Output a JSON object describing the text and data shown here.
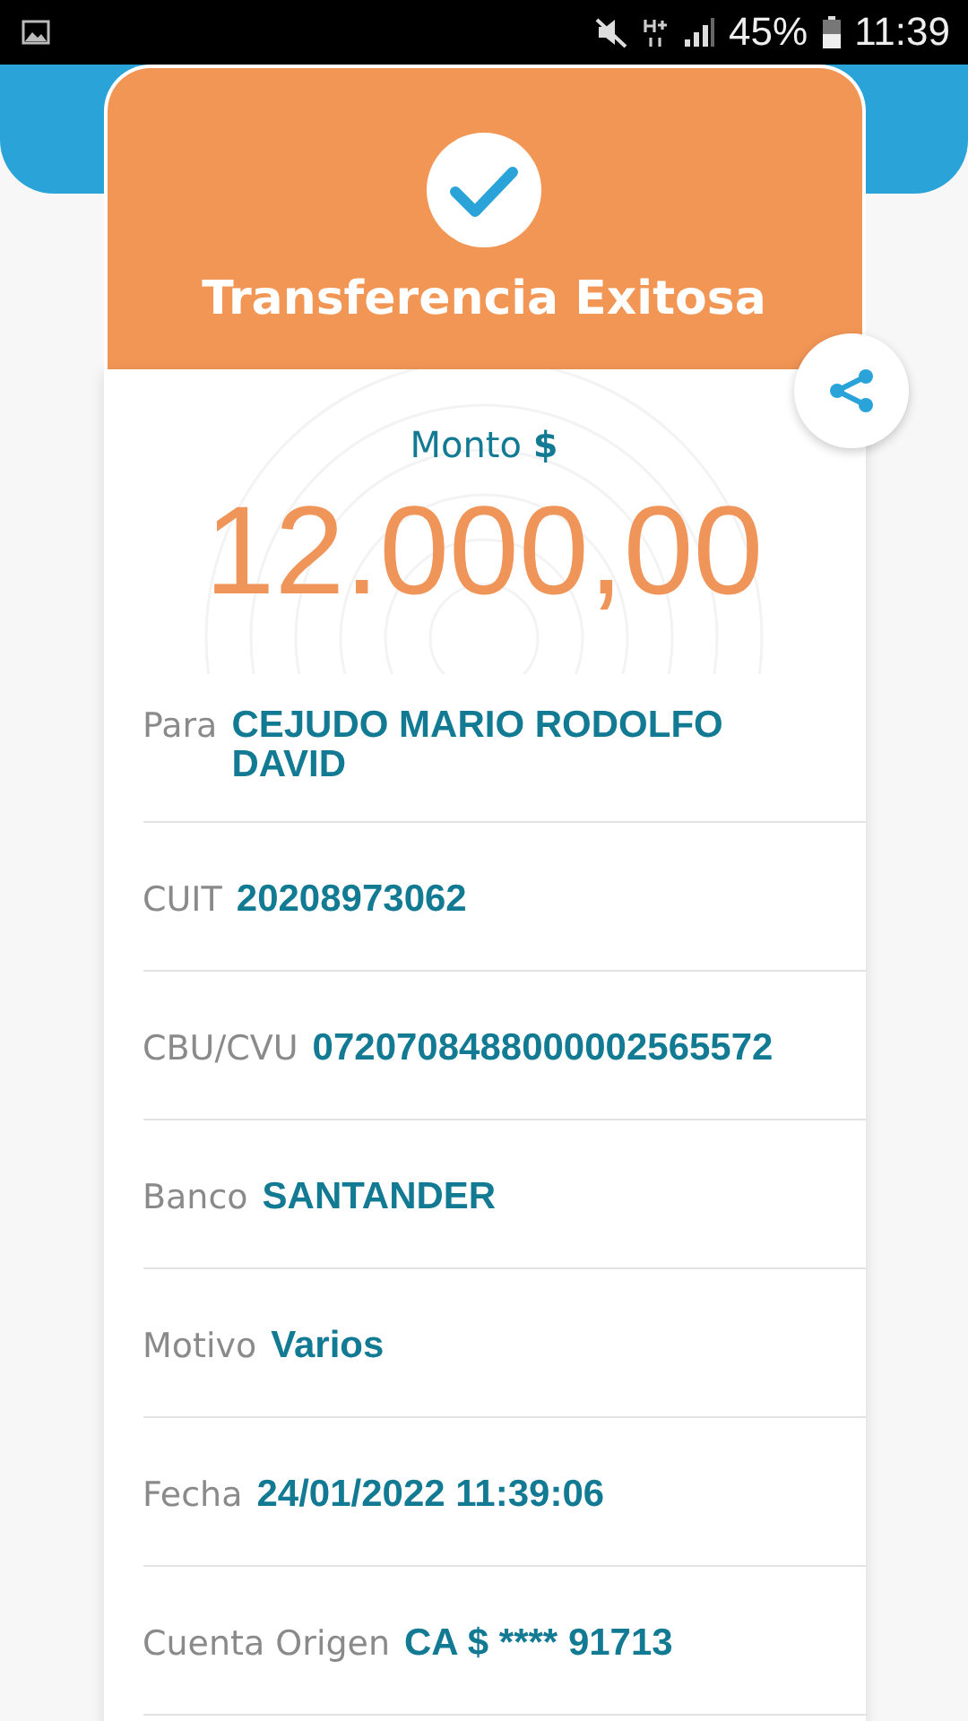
{
  "status_bar": {
    "battery": "45%",
    "time": "11:39"
  },
  "title": "Transferencia Exitosa",
  "amount_label": "Monto **$**",
  "amount": "12.000,00",
  "details": [
    {
      "label": "Para",
      "value": "CEJUDO MARIO RODOLFO DAVID"
    },
    {
      "label": "CUIT",
      "value": "20208973062"
    },
    {
      "label": "CBU/CVU",
      "value": "0720708488000002565572"
    },
    {
      "label": "Banco",
      "value": "SANTANDER"
    },
    {
      "label": "Motivo",
      "value": "Varios"
    },
    {
      "label": "Fecha",
      "value": "24/01/2022 11:39:06"
    },
    {
      "label": "Cuenta Origen",
      "value": "CA $ **** 91713"
    }
  ]
}
